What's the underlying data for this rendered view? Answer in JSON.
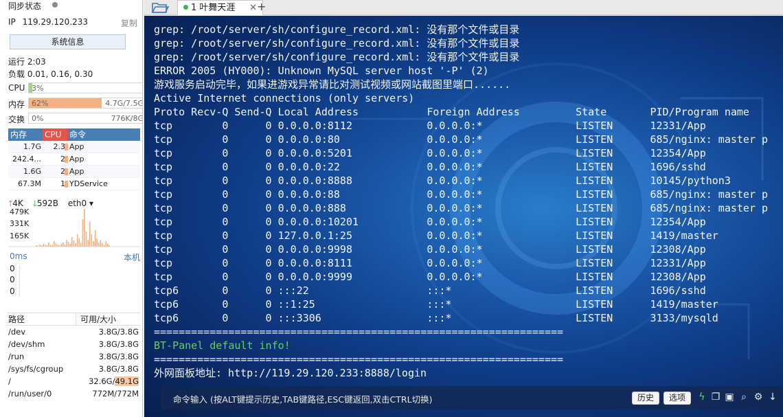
{
  "sidebar": {
    "status_title": "同步状态",
    "ip_label": "IP",
    "ip_value": "119.29.120.233",
    "copy_label": "复制",
    "sysinfo_label": "系统信息",
    "uptime": "运行 2:03",
    "load": "负载 0.01, 0.16, 0.30",
    "cpu": {
      "label": "CPU",
      "text": "3%",
      "percent": 3
    },
    "mem": {
      "label": "内存",
      "text": "62%",
      "right": "4.7G/7.5G",
      "percent": 62
    },
    "swap": {
      "label": "交换",
      "text": "0%",
      "right": "776K/8G",
      "percent": 0
    },
    "proc_headers": {
      "mem": "内存",
      "cpu": "CPU",
      "cmd": "命令"
    },
    "procs": [
      {
        "mem": "1.7G",
        "cpu": "2.3",
        "cmd": "App"
      },
      {
        "mem": "242.4...",
        "cpu": "2",
        "cmd": "App"
      },
      {
        "mem": "1.6G",
        "cpu": "2",
        "cmd": "App"
      },
      {
        "mem": "67.3M",
        "cpu": "1",
        "cmd": "YDService"
      }
    ],
    "net": {
      "up": "4K",
      "down": "592B",
      "iface": "eth0"
    },
    "net_ticks": [
      "479K",
      "331K",
      "165K"
    ],
    "latency": {
      "label": "0ms",
      "right": "本机",
      "values": [
        "0",
        "0",
        "0"
      ]
    },
    "disk_headers": {
      "path": "路径",
      "size": "可用/大小"
    },
    "disks": [
      {
        "path": "/dev",
        "size": "3.8G/3.8G"
      },
      {
        "path": "/dev/shm",
        "size": "3.8G/3.8G"
      },
      {
        "path": "/run",
        "size": "3.8G/3.8G"
      },
      {
        "path": "/sys/fs/cgroup",
        "size": "3.8G/3.8G"
      },
      {
        "path": "/",
        "size_free": "32.6G/",
        "size_total": "49.1G"
      },
      {
        "path": "/run/user/0",
        "size": "772M/772M"
      }
    ]
  },
  "tabs": [
    {
      "label": "1 叶舞天涯"
    }
  ],
  "terminal": {
    "lines": [
      {
        "text": "grep: /root/server/sh/configure_record.xml: 没有那个文件或目录"
      },
      {
        "text": "grep: /root/server/sh/configure_record.xml: 没有那个文件或目录"
      },
      {
        "text": "grep: /root/server/sh/configure_record.xml: 没有那个文件或目录"
      },
      {
        "text": "ERROR 2005 (HY000): Unknown MySQL server host '-P' (2)"
      },
      {
        "text": "游戏服务启动完毕，如果进游戏异常请比对测试视频或网站截图里端口......"
      },
      {
        "text": "Active Internet connections (only servers)"
      },
      {
        "text": "Proto Recv-Q Send-Q Local Address           Foreign Address         State       PID/Program name"
      },
      {
        "text": "tcp        0      0 0.0.0.0:8112            0.0.0.0:*               LISTEN      12331/App"
      },
      {
        "text": "tcp        0      0 0.0.0.0:80              0.0.0.0:*               LISTEN      685/nginx: master p"
      },
      {
        "text": "tcp        0      0 0.0.0.0:5201            0.0.0.0:*               LISTEN      12354/App"
      },
      {
        "text": "tcp        0      0 0.0.0.0:22              0.0.0.0:*               LISTEN      1696/sshd"
      },
      {
        "text": "tcp        0      0 0.0.0.0:8888            0.0.0.0:*               LISTEN      10145/python3"
      },
      {
        "text": "tcp        0      0 0.0.0.0:88              0.0.0.0:*               LISTEN      685/nginx: master p"
      },
      {
        "text": "tcp        0      0 0.0.0.0:888             0.0.0.0:*               LISTEN      685/nginx: master p"
      },
      {
        "text": "tcp        0      0 0.0.0.0:10201           0.0.0.0:*               LISTEN      12354/App"
      },
      {
        "text": "tcp        0      0 127.0.0.1:25            0.0.0.0:*               LISTEN      1419/master"
      },
      {
        "text": "tcp        0      0 0.0.0.0:9998            0.0.0.0:*               LISTEN      12308/App"
      },
      {
        "text": "tcp        0      0 0.0.0.0:8111            0.0.0.0:*               LISTEN      12331/App"
      },
      {
        "text": "tcp        0      0 0.0.0.0:9999            0.0.0.0:*               LISTEN      12308/App"
      },
      {
        "text": "tcp6       0      0 :::22                   :::*                    LISTEN      1696/sshd"
      },
      {
        "text": "tcp6       0      0 ::1:25                  :::*                    LISTEN      1419/master"
      },
      {
        "text": "tcp6       0      0 :::3306                 :::*                    LISTEN      3133/mysqld"
      },
      {
        "text": "==================================================================",
        "kind": "sep"
      },
      {
        "text": "BT-Panel default info!",
        "kind": "green"
      },
      {
        "text": "==================================================================",
        "kind": "sep"
      },
      {
        "text": "外网面板地址: http://119.29.120.233:8888/login"
      }
    ]
  },
  "cmdbar": {
    "hint": "命令输入 (按ALT键提示历史,TAB键路径,ESC键返回,双击CTRL切换)",
    "history_label": "历史",
    "options_label": "选项"
  },
  "colors": {
    "accent": "#4a7fb5",
    "cpu_header": "#e0564a",
    "mem_bar": "#f4b183",
    "terminal_green": "#5fd35a"
  }
}
